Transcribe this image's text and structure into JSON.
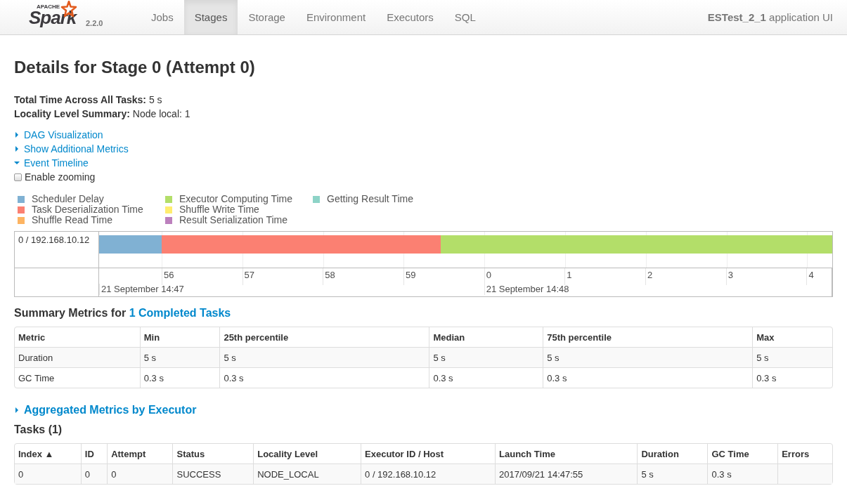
{
  "navbar": {
    "logo_text": "Spark",
    "logo_small": "APACHE",
    "version": "2.2.0",
    "tabs": [
      {
        "label": "Jobs",
        "selected": false
      },
      {
        "label": "Stages",
        "selected": true
      },
      {
        "label": "Storage",
        "selected": false
      },
      {
        "label": "Environment",
        "selected": false
      },
      {
        "label": "Executors",
        "selected": false
      },
      {
        "label": "SQL",
        "selected": false
      }
    ],
    "app_name": "ESTest_2_1",
    "app_suffix": "application UI"
  },
  "title": "Details for Stage 0 (Attempt 0)",
  "summary": [
    {
      "label": "Total Time Across All Tasks:",
      "value": "5 s"
    },
    {
      "label": "Locality Level Summary:",
      "value": "Node local: 1"
    }
  ],
  "toggles": [
    {
      "label": "DAG Visualization",
      "expanded": false
    },
    {
      "label": "Show Additional Metrics",
      "expanded": false
    },
    {
      "label": "Event Timeline",
      "expanded": true
    }
  ],
  "enable_zooming": {
    "label": "Enable zooming",
    "checked": false
  },
  "legend": [
    {
      "label": "Scheduler Delay",
      "color": "#80b1d3"
    },
    {
      "label": "Task Deserialization Time",
      "color": "#fb8072"
    },
    {
      "label": "Shuffle Read Time",
      "color": "#fdb462"
    },
    {
      "label": "Executor Computing Time",
      "color": "#b3de69"
    },
    {
      "label": "Shuffle Write Time",
      "color": "#ffed6f"
    },
    {
      "label": "Result Serialization Time",
      "color": "#bc80bd"
    },
    {
      "label": "Getting Result Time",
      "color": "#8dd3c7"
    }
  ],
  "timeline": {
    "row_label": "0 / 192.168.10.12",
    "ticks": [
      "56",
      "57",
      "58",
      "59",
      "0",
      "1",
      "2",
      "3",
      "4"
    ],
    "dates": [
      "21 September 14:47",
      "21 September 14:48"
    ]
  },
  "summary_metrics": {
    "heading": "Summary Metrics for",
    "link": "1 Completed Tasks",
    "columns": [
      "Metric",
      "Min",
      "25th percentile",
      "Median",
      "75th percentile",
      "Max"
    ],
    "rows": [
      [
        "Duration",
        "5 s",
        "5 s",
        "5 s",
        "5 s",
        "5 s"
      ],
      [
        "GC Time",
        "0.3 s",
        "0.3 s",
        "0.3 s",
        "0.3 s",
        "0.3 s"
      ]
    ]
  },
  "aggregated": {
    "label": "Aggregated Metrics by Executor",
    "expanded": false
  },
  "tasks": {
    "heading": "Tasks (1)",
    "columns": [
      "Index ▲",
      "ID",
      "Attempt",
      "Status",
      "Locality Level",
      "Executor ID / Host",
      "Launch Time",
      "Duration",
      "GC Time",
      "Errors"
    ],
    "rows": [
      [
        "0",
        "0",
        "0",
        "SUCCESS",
        "NODE_LOCAL",
        "0 / 192.168.10.12",
        "2017/09/21 14:47:55",
        "5 s",
        "0.3 s",
        ""
      ]
    ]
  }
}
